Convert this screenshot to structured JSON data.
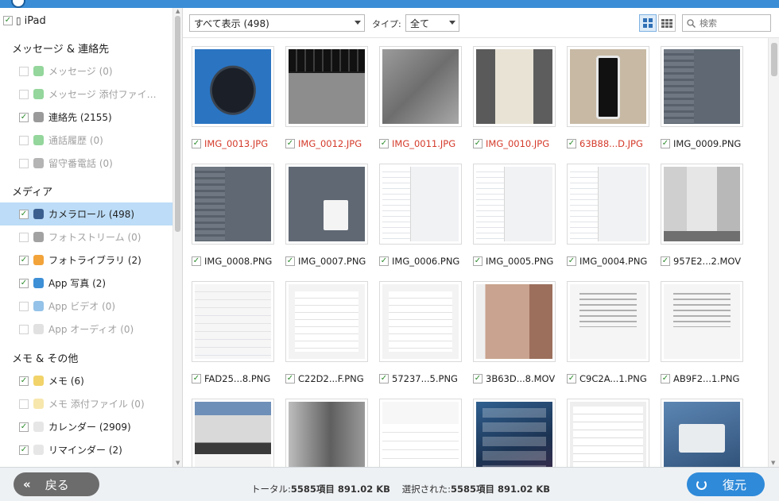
{
  "window": {
    "title": ""
  },
  "sidebar": {
    "device": "iPad",
    "sections": [
      {
        "title": "メッセージ & 連絡先",
        "items": [
          {
            "label": "メッセージ (0)",
            "checked": false,
            "enabled": false,
            "icon": "message-icon"
          },
          {
            "label": "メッセージ 添付ファイ…",
            "checked": false,
            "enabled": false,
            "icon": "message-attachment-icon"
          },
          {
            "label": "連絡先 (2155)",
            "checked": true,
            "enabled": true,
            "icon": "contacts-icon"
          },
          {
            "label": "通話履歴 (0)",
            "checked": false,
            "enabled": false,
            "icon": "phone-icon"
          },
          {
            "label": "留守番電話 (0)",
            "checked": false,
            "enabled": false,
            "icon": "voicemail-icon"
          }
        ]
      },
      {
        "title": "メディア",
        "items": [
          {
            "label": "カメラロール (498)",
            "checked": true,
            "enabled": true,
            "selected": true,
            "icon": "camera-roll-icon"
          },
          {
            "label": "フォトストリーム (0)",
            "checked": false,
            "enabled": false,
            "icon": "photo-stream-icon"
          },
          {
            "label": "フォトライブラリ (2)",
            "checked": true,
            "enabled": true,
            "icon": "photo-library-icon"
          },
          {
            "label": "App 写真 (2)",
            "checked": true,
            "enabled": true,
            "icon": "app-photos-icon"
          },
          {
            "label": "App ビデオ (0)",
            "checked": false,
            "enabled": false,
            "icon": "app-video-icon"
          },
          {
            "label": "App オーディオ (0)",
            "checked": false,
            "enabled": false,
            "icon": "app-audio-icon"
          }
        ]
      },
      {
        "title": "メモ & その他",
        "items": [
          {
            "label": "メモ (6)",
            "checked": true,
            "enabled": true,
            "icon": "notes-icon"
          },
          {
            "label": "メモ 添付ファイル (0)",
            "checked": false,
            "enabled": false,
            "icon": "notes-attachment-icon"
          },
          {
            "label": "カレンダー (2909)",
            "checked": true,
            "enabled": true,
            "icon": "calendar-icon"
          },
          {
            "label": "リマインダー (2)",
            "checked": true,
            "enabled": true,
            "icon": "reminder-icon"
          }
        ]
      }
    ]
  },
  "toolbar": {
    "filter_value": "すべて表示 (498)",
    "type_label": "タイプ:",
    "type_value": "全て",
    "search_placeholder": "検索"
  },
  "files": [
    {
      "name": "IMG_0013.JPG",
      "red": true,
      "thumb": "t-mouse"
    },
    {
      "name": "IMG_0012.JPG",
      "red": true,
      "thumb": "t-keyboard"
    },
    {
      "name": "IMG_0011.JPG",
      "red": true,
      "thumb": "t-floor"
    },
    {
      "name": "IMG_0010.JPG",
      "red": true,
      "thumb": "t-bottle"
    },
    {
      "name": "63B88...D.JPG",
      "red": true,
      "thumb": "t-phone"
    },
    {
      "name": "IMG_0009.PNG",
      "red": false,
      "thumb": "t-settings-dark"
    },
    {
      "name": "IMG_0008.PNG",
      "red": false,
      "thumb": "t-settings-dark"
    },
    {
      "name": "IMG_0007.PNG",
      "red": false,
      "thumb": "t-popup"
    },
    {
      "name": "IMG_0006.PNG",
      "red": false,
      "thumb": "t-settings-light"
    },
    {
      "name": "IMG_0005.PNG",
      "red": false,
      "thumb": "t-settings-light"
    },
    {
      "name": "IMG_0004.PNG",
      "red": false,
      "thumb": "t-settings-light"
    },
    {
      "name": "957E2...2.MOV",
      "red": false,
      "thumb": "t-room"
    },
    {
      "name": "FAD25...8.PNG",
      "red": false,
      "thumb": "t-list"
    },
    {
      "name": "C22D2...F.PNG",
      "red": false,
      "thumb": "t-list2"
    },
    {
      "name": "57237...5.PNG",
      "red": false,
      "thumb": "t-list2"
    },
    {
      "name": "3B63D...8.MOV",
      "red": false,
      "thumb": "t-skin"
    },
    {
      "name": "C9C2A...1.PNG",
      "red": false,
      "thumb": "t-text"
    },
    {
      "name": "AB9F2...1.PNG",
      "red": false,
      "thumb": "t-text"
    },
    {
      "name": "",
      "red": false,
      "thumb": "t-collage"
    },
    {
      "name": "",
      "red": false,
      "thumb": "t-metal"
    },
    {
      "name": "",
      "red": false,
      "thumb": "t-contact"
    },
    {
      "name": "",
      "red": false,
      "thumb": "t-home"
    },
    {
      "name": "",
      "red": false,
      "thumb": "t-wifi"
    },
    {
      "name": "",
      "red": false,
      "thumb": "t-alert"
    }
  ],
  "footer": {
    "back_label": "戻る",
    "status_total_label": "トータル:",
    "status_total_value": "5585項目 891.02 KB",
    "status_selected_label": "選択された:",
    "status_selected_value": "5585項目 891.02 KB",
    "restore_label": "復元"
  },
  "colors": {
    "accent": "#2f8ad9",
    "selected_row": "#bcdcf7",
    "unsaved_filename": "#d43a2a",
    "check": "#2b8a2b"
  }
}
